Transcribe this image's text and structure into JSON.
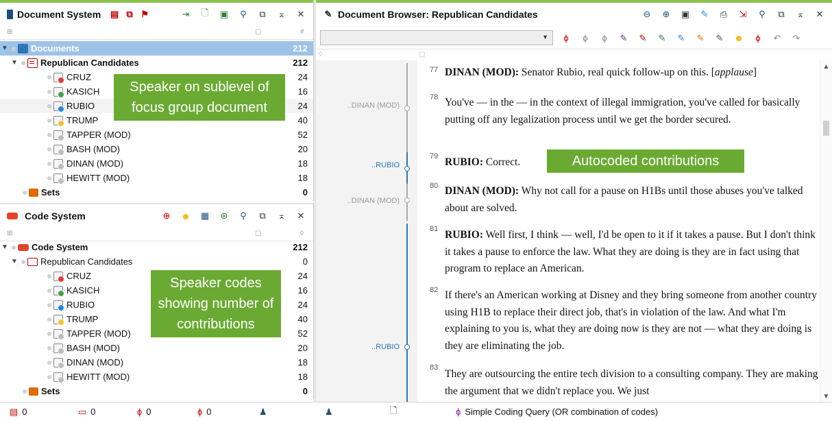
{
  "doc_system": {
    "title": "Document System",
    "header_icons": [
      "doc-red-icon",
      "doc-copy-icon",
      "doc-flag-icon",
      "import-icon",
      "new-doc-icon",
      "new-folder-icon",
      "search-icon",
      "undock-icon",
      "minimize-icon",
      "close-icon"
    ],
    "items": [
      {
        "label": "Documents",
        "count": "212"
      },
      {
        "label": "Republican Candidates",
        "count": "212"
      },
      {
        "label": "CRUZ",
        "count": "24"
      },
      {
        "label": "KASICH",
        "count": "16"
      },
      {
        "label": "RUBIO",
        "count": "24"
      },
      {
        "label": "TRUMP",
        "count": "40"
      },
      {
        "label": "TAPPER (MOD)",
        "count": "52"
      },
      {
        "label": "BASH (MOD)",
        "count": "20"
      },
      {
        "label": "DINAN (MOD)",
        "count": "18"
      },
      {
        "label": "HEWITT (MOD)",
        "count": "18"
      },
      {
        "label": "Sets",
        "count": "0"
      }
    ],
    "callout": "Speaker on sublevel of focus group document"
  },
  "code_system": {
    "title": "Code System",
    "items": [
      {
        "label": "Code System",
        "count": "212"
      },
      {
        "label": "Republican Candidates",
        "count": "0"
      },
      {
        "label": "CRUZ",
        "count": "24"
      },
      {
        "label": "KASICH",
        "count": "16"
      },
      {
        "label": "RUBIO",
        "count": "24"
      },
      {
        "label": "TRUMP",
        "count": "40"
      },
      {
        "label": "TAPPER (MOD)",
        "count": "52"
      },
      {
        "label": "BASH (MOD)",
        "count": "20"
      },
      {
        "label": "DINAN (MOD)",
        "count": "18"
      },
      {
        "label": "HEWITT (MOD)",
        "count": "18"
      },
      {
        "label": "Sets",
        "count": "0"
      }
    ],
    "callout": "Speaker codes showing number of contributions"
  },
  "browser": {
    "title": "Document Browser: Republican Candidates",
    "callout": "Autocoded contributions",
    "paragraphs": [
      {
        "num": "77",
        "speaker": "DINAN (MOD):",
        "text": " Senator Rubio, real quick follow-up on this. [",
        "italic": "applause",
        "tail": "]"
      },
      {
        "num": "78",
        "speaker": "",
        "text": "You've — in the — in the context of illegal immigration, you've called for basically putting off any legalization process until we get the border secured.",
        "italic": "",
        "tail": ""
      },
      {
        "num": "79",
        "speaker": "RUBIO:",
        "text": " Correct.",
        "italic": "",
        "tail": ""
      },
      {
        "num": "80",
        "speaker": "DINAN (MOD):",
        "text": " Why not call for a pause on H1Bs until those abuses you've talked about are solved.",
        "italic": "",
        "tail": ""
      },
      {
        "num": "81",
        "speaker": "RUBIO:",
        "text": " Well first, I think — well, I'd be open to it if it takes a pause. But I don't think it takes a pause to enforce the law. What they are doing is they are in fact using that program to replace an American.",
        "italic": "",
        "tail": ""
      },
      {
        "num": "82",
        "speaker": "",
        "text": "If there's an American working at Disney and they bring someone from another country using H1B to replace their direct job, that's in violation of the law. And what I'm explaining to you is, what they are doing now is they are not — what they are doing is they are eliminating the job.",
        "italic": "",
        "tail": ""
      },
      {
        "num": "83",
        "speaker": "",
        "text": "They are outsourcing the entire tech division to a consulting company. They are making the argument that we didn't replace you. We just",
        "italic": "",
        "tail": ""
      }
    ],
    "margin_labels": [
      "..DINAN (MOD)",
      "..RUBIO",
      "..DINAN (MOD)",
      "..RUBIO"
    ]
  },
  "status_bar": {
    "items": [
      "0",
      "0",
      "0",
      "0"
    ],
    "query": "Simple Coding Query (OR combination of codes)"
  },
  "colors": {
    "accent_green": "#8cc34a",
    "callout_green": "#6aaa32",
    "selection_blue": "#9dc3e6",
    "rubio_blue": "#2e75b6"
  }
}
